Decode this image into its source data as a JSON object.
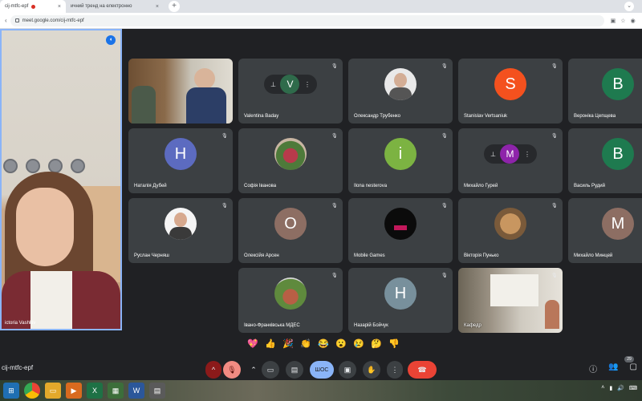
{
  "browser": {
    "tabs": [
      {
        "title": "cij-mtfc-epf",
        "close": "×"
      },
      {
        "title": "ичний тренд на електронно",
        "close": "×"
      }
    ],
    "new_tab": "+",
    "url": "meet.google.com/cij-mtfc-epf"
  },
  "speaker": {
    "name": "ictoria Vashkiv"
  },
  "tiles": [
    {
      "name": "Valentina Baday",
      "initial": "V",
      "color": "#2f6b4b"
    },
    {
      "name": "Олександр Трубенко",
      "initial": "",
      "color": ""
    },
    {
      "name": "Stanislav Vertsaniuk",
      "initial": "S",
      "color": "#f4511e"
    },
    {
      "name": "Вероніка Цепщева",
      "initial": "В",
      "color": "#1e7a4f"
    },
    {
      "name": "Наталія Дубей",
      "initial": "Н",
      "color": "#5c6bc0"
    },
    {
      "name": "Софія Іванова",
      "initial": "",
      "color": ""
    },
    {
      "name": "Ilona nesterova",
      "initial": "i",
      "color": "#7cb342"
    },
    {
      "name": "Михайло Гурей",
      "initial": "М",
      "color": "#8e24aa"
    },
    {
      "name": "Василь Рудий",
      "initial": "В",
      "color": "#1e7a4f"
    },
    {
      "name": "Руслан Черняш",
      "initial": "",
      "color": ""
    },
    {
      "name": "Олексійя Арсен",
      "initial": "О",
      "color": "#8d6e63"
    },
    {
      "name": "Mobile Games",
      "initial": "",
      "color": "#111"
    },
    {
      "name": "Вікторія Пунько",
      "initial": "",
      "color": ""
    },
    {
      "name": "Михайло Минцей",
      "initial": "М",
      "color": "#8d6e63"
    },
    {
      "name": "Івано-Франківська МДЕС",
      "initial": "",
      "color": ""
    },
    {
      "name": "Назарій Бойчук",
      "initial": "Н",
      "color": "#78909c"
    },
    {
      "name": "Кафедр",
      "initial": "",
      "color": ""
    }
  ],
  "reactions": [
    "💖",
    "👍",
    "🎉",
    "👏",
    "😂",
    "😮",
    "😢",
    "🤔",
    "👎"
  ],
  "meeting_code": "cij-mtfc-epf",
  "participant_count": "29",
  "controls": {
    "present_label": "ШОС"
  }
}
